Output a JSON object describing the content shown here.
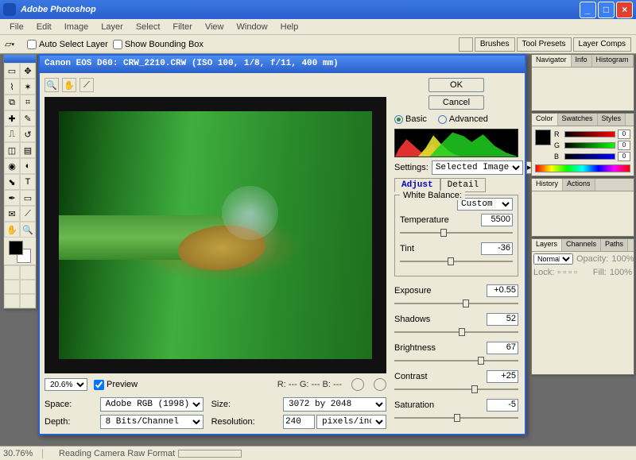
{
  "window": {
    "title": "Adobe Photoshop"
  },
  "menubar": [
    "File",
    "Edit",
    "Image",
    "Layer",
    "Select",
    "Filter",
    "View",
    "Window",
    "Help"
  ],
  "optbar": {
    "auto_select_label": "Auto Select Layer",
    "auto_select_checked": false,
    "bbox_label": "Show Bounding Box",
    "bbox_checked": false,
    "palette_buttons": [
      "Brushes",
      "Tool Presets",
      "Layer Comps"
    ]
  },
  "raw": {
    "title": "Canon EOS D60:  CRW_2210.CRW  (ISO 100, 1/8, f/11, 400 mm)",
    "ok": "OK",
    "cancel": "Cancel",
    "mode_basic": "Basic",
    "mode_advanced": "Advanced",
    "mode_selected": "basic",
    "zoom": "20.6%",
    "preview_label": "Preview",
    "preview_checked": true,
    "rgb_readout": "R: --- G: --- B: ---",
    "space_label": "Space:",
    "space_value": "Adobe RGB (1998)",
    "size_label": "Size:",
    "size_value": "3072 by 2048",
    "depth_label": "Depth:",
    "depth_value": "8 Bits/Channel",
    "res_label": "Resolution:",
    "res_value": "240",
    "res_unit": "pixels/inch",
    "settings_label": "Settings:",
    "settings_value": "Selected Image",
    "tab_adjust": "Adjust",
    "tab_detail": "Detail",
    "wb_label": "White Balance:",
    "wb_value": "Custom",
    "temperature_label": "Temperature",
    "temperature_value": "5500",
    "tint_label": "Tint",
    "tint_value": "-36",
    "exposure_label": "Exposure",
    "exposure_value": "+0.55",
    "shadows_label": "Shadows",
    "shadows_value": "52",
    "brightness_label": "Brightness",
    "brightness_value": "67",
    "contrast_label": "Contrast",
    "contrast_value": "+25",
    "saturation_label": "Saturation",
    "saturation_value": "-5"
  },
  "palettes": {
    "nav_tabs": [
      "Navigator",
      "Info",
      "Histogram"
    ],
    "color_tabs": [
      "Color",
      "Swatches",
      "Styles"
    ],
    "rgb": {
      "r": "0",
      "g": "0",
      "b": "0"
    },
    "hist_tabs": [
      "History",
      "Actions"
    ],
    "layer_tabs": [
      "Layers",
      "Channels",
      "Paths"
    ],
    "blend": "Normal",
    "opacity_label": "Opacity:",
    "opacity": "100%",
    "lock_label": "Lock:",
    "fill_label": "Fill:",
    "fill": "100%"
  },
  "status": {
    "zoom": "30.76%",
    "task": "Reading Camera Raw Format"
  }
}
